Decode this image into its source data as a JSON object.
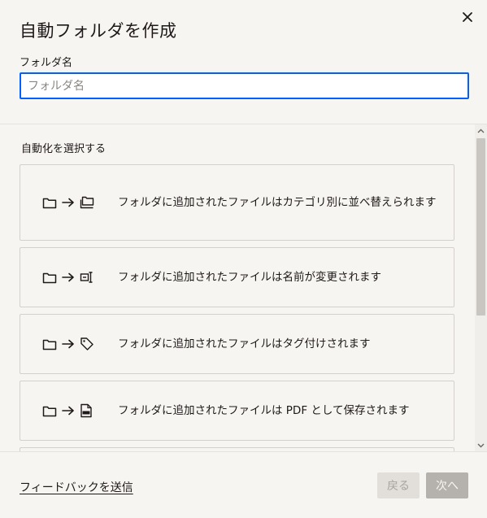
{
  "dialog": {
    "title": "自動フォルダを作成",
    "close_icon": "close-icon"
  },
  "folder_name": {
    "label": "フォルダ名",
    "placeholder": "フォルダ名",
    "value": ""
  },
  "automation": {
    "section_label": "自動化を選択する",
    "options": [
      {
        "icon_from": "folder-icon",
        "icon_to": "folders-icon",
        "text": "フォルダに追加されたファイルはカテゴリ別に並べ替えられます"
      },
      {
        "icon_from": "folder-icon",
        "icon_to": "rename-icon",
        "text": "フォルダに追加されたファイルは名前が変更されます"
      },
      {
        "icon_from": "folder-icon",
        "icon_to": "tag-icon",
        "text": "フォルダに追加されたファイルはタグ付けされます"
      },
      {
        "icon_from": "folder-icon",
        "icon_to": "pdf-icon",
        "text": "フォルダに追加されたファイルは PDF として保存されます"
      }
    ]
  },
  "footer": {
    "feedback_link": "フィードバックを送信",
    "back_button": "戻る",
    "next_button": "次へ"
  }
}
